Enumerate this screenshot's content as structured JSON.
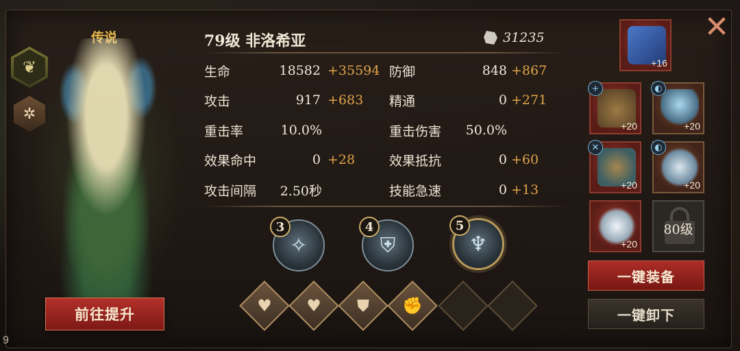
{
  "hero": {
    "rarity": "传说",
    "name": "79级  非洛希亚",
    "power": "31235",
    "upgrade_button": "前往提升"
  },
  "stats": [
    {
      "label": "生命",
      "value": "18582",
      "bonus": "+35594"
    },
    {
      "label": "攻击",
      "value": "917",
      "bonus": "+683"
    },
    {
      "label": "重击率",
      "value": "10.0%",
      "bonus": ""
    },
    {
      "label": "效果命中",
      "value": "0",
      "bonus": "+28"
    },
    {
      "label": "攻击间隔",
      "value": "2.50秒",
      "bonus": ""
    },
    {
      "label": "防御",
      "value": "848",
      "bonus": "+867"
    },
    {
      "label": "精通",
      "value": "0",
      "bonus": "+271"
    },
    {
      "label": "重击伤害",
      "value": "50.0%",
      "bonus": ""
    },
    {
      "label": "效果抵抗",
      "value": "0",
      "bonus": "+60"
    },
    {
      "label": "技能急速",
      "value": "0",
      "bonus": "+13"
    }
  ],
  "skills": [
    {
      "number": "3",
      "icon": "rune-icon"
    },
    {
      "number": "4",
      "icon": "shield-blade-icon"
    },
    {
      "number": "5",
      "icon": "spirit-icon"
    }
  ],
  "talents": [
    {
      "icon": "heart-icon",
      "glyph": "♥"
    },
    {
      "icon": "heart-heal-icon",
      "glyph": "♥"
    },
    {
      "icon": "shield-icon",
      "glyph": "⛊"
    },
    {
      "icon": "muscle-icon",
      "glyph": "✊"
    },
    {
      "icon": "empty-slot",
      "glyph": ""
    },
    {
      "icon": "empty-slot",
      "glyph": ""
    }
  ],
  "equipment": {
    "book": {
      "level": "+16"
    },
    "helmet": {
      "level": "+20"
    },
    "staff": {
      "level": "+20"
    },
    "armor": {
      "level": "+20"
    },
    "wing": {
      "level": "+20"
    },
    "gem": {
      "level": "+20"
    },
    "locked": {
      "label": "80级"
    },
    "equip_all": "一键装备",
    "unequip_all": "一键卸下"
  },
  "corner_label": "9"
}
